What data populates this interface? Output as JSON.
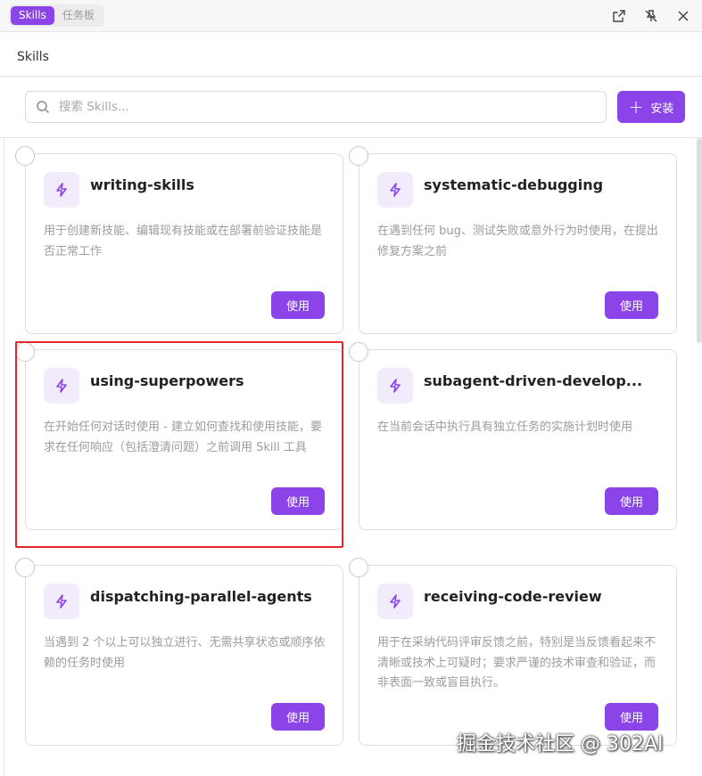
{
  "tabs": [
    {
      "label": "Skills",
      "active": true
    },
    {
      "label": "任务板",
      "active": false
    }
  ],
  "window_icons": [
    "external-link-icon",
    "unpin-icon",
    "close-icon"
  ],
  "page_title": "Skills",
  "search": {
    "placeholder": "搜索 Skills...",
    "value": ""
  },
  "install_label": "安装",
  "use_label": "使用",
  "accent_color": "#8a44e8",
  "highlight_color": "#e3262b",
  "skills": [
    {
      "name": "writing-skills",
      "desc": "用于创建新技能、编辑现有技能或在部署前验证技能是否正常工作"
    },
    {
      "name": "systematic-debugging",
      "desc": "在遇到任何 bug、测试失败或意外行为时使用，在提出修复方案之前"
    },
    {
      "name": "using-superpowers",
      "desc": "在开始任何对话时使用 - 建立如何查找和使用技能，要求在任何响应（包括澄清问题）之前调用 Skill 工具"
    },
    {
      "name": "subagent-driven-develop...",
      "desc": "在当前会话中执行具有独立任务的实施计划时使用"
    },
    {
      "name": "dispatching-parallel-agents",
      "desc": "当遇到 2 个以上可以独立进行、无需共享状态或顺序依赖的任务时使用"
    },
    {
      "name": "receiving-code-review",
      "desc": "用于在采纳代码评审反馈之前，特别是当反馈看起来不清晰或技术上可疑时；要求严谨的技术审查和验证，而非表面一致或盲目执行。"
    }
  ],
  "watermark": "掘金技术社区 @ 302AI"
}
